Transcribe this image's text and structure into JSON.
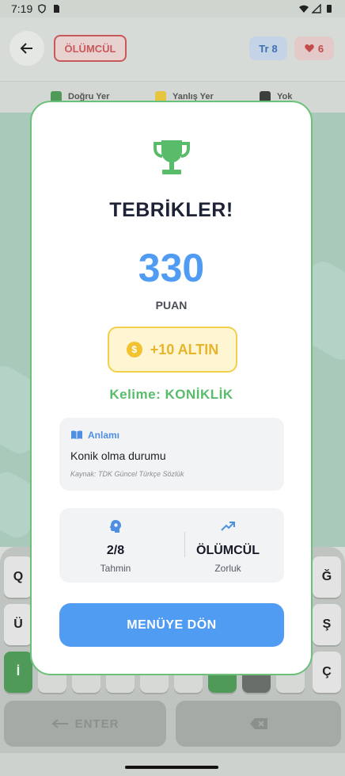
{
  "status_bar": {
    "time": "7:19"
  },
  "header": {
    "mode_badge": "ÖLÜMCÜL",
    "hint_count": "8",
    "hint_icon": "Tr",
    "lives_count": "6"
  },
  "legend": [
    {
      "label": "Doğru Yer",
      "color": "#4f9a58"
    },
    {
      "label": "Yanlış Yer",
      "color": "#e6c640"
    },
    {
      "label": "Yok",
      "color": "#3d3f3d"
    }
  ],
  "keyboard": {
    "row1_left": "Q",
    "row1_right": "Ğ",
    "row2_left": "Ü",
    "row2_right": "Ş",
    "row3_left": "İ",
    "row3_right": "Ç",
    "enter_label": "ENTER"
  },
  "modal": {
    "title": "TEBRİKLER!",
    "score": "330",
    "score_label": "PUAN",
    "gold_reward": "+10 ALTIN",
    "word_line": "Kelime: KONİKLİK",
    "meaning": {
      "heading": "Anlamı",
      "text": "Konik olma durumu",
      "source": "Kaynak: TDK Güncel Türkçe Sözlük"
    },
    "stats": {
      "guesses_value": "2/8",
      "guesses_label": "Tahmin",
      "difficulty_value": "ÖLÜMCÜL",
      "difficulty_label": "Zorluk"
    },
    "menu_button": "MENÜYE DÖN"
  },
  "colors": {
    "accent_blue": "#4f9cf2",
    "success_green": "#58bc6b",
    "gold": "#e8b42b",
    "danger_red": "#c9585a"
  }
}
